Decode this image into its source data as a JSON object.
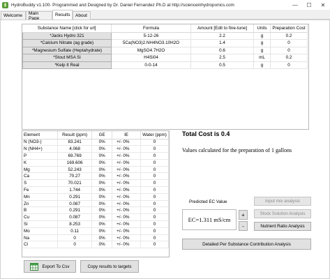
{
  "window": {
    "title": "HydroBuddy v1.100- Programmed and Designed by Dr. Daniel Fernandez Ph.D at http://scienceinhydroponics.com",
    "minimize_glyph": "—",
    "maximize_glyph": "☐",
    "close_glyph": "✕"
  },
  "tabs": [
    {
      "label": "Welcome"
    },
    {
      "label": "Main Page"
    },
    {
      "label": "Results"
    },
    {
      "label": "About"
    }
  ],
  "substances": {
    "columns": [
      "Substance Name [click for url]",
      "Formula",
      "Amount [Edit to fine-tune]",
      "Units",
      "Preparation Cost"
    ],
    "rows": [
      {
        "name": "*Jacks Hydro 321",
        "formula": "5-12-26",
        "amount": "2.2",
        "units": "g",
        "cost": "0.2"
      },
      {
        "name": "*Calcium Nitrate (ag grade)",
        "formula": "5Ca(NO3)2.NH4NO3.10H2O",
        "amount": "1.4",
        "units": "g",
        "cost": "0"
      },
      {
        "name": "*Magnesium Sulfate (Heptahydrate)",
        "formula": "MgSO4.7H2O",
        "amount": "0.6",
        "units": "g",
        "cost": "0"
      },
      {
        "name": "*Stout MSA Si",
        "formula": "H4Si04",
        "amount": "2.5",
        "units": "mL",
        "cost": "0.2"
      },
      {
        "name": "*Kelp It Real",
        "formula": "0-0-14",
        "amount": "0.5",
        "units": "g",
        "cost": "0"
      }
    ]
  },
  "elements": {
    "columns": [
      "Element",
      "Result (ppm)",
      "GE",
      "IE",
      "Water (ppm)"
    ],
    "rows": [
      {
        "element": "N (NO3-)",
        "result": "83.241",
        "ge": "0%",
        "ie": "+/- 0%",
        "water": "0"
      },
      {
        "element": "N (NH4+)",
        "result": "4.068",
        "ge": "0%",
        "ie": "+/- 0%",
        "water": "0"
      },
      {
        "element": "P",
        "result": "69.769",
        "ge": "0%",
        "ie": "+/- 0%",
        "water": "0"
      },
      {
        "element": "K",
        "result": "169.606",
        "ge": "0%",
        "ie": "+/- 0%",
        "water": "0"
      },
      {
        "element": "Mg",
        "result": "52.243",
        "ge": "0%",
        "ie": "+/- 0%",
        "water": "0"
      },
      {
        "element": "Ca",
        "result": "70.27",
        "ge": "0%",
        "ie": "+/- 0%",
        "water": "0"
      },
      {
        "element": "S",
        "result": "70.021",
        "ge": "0%",
        "ie": "+/- 0%",
        "water": "0"
      },
      {
        "element": "Fe",
        "result": "1.744",
        "ge": "0%",
        "ie": "+/- 0%",
        "water": "0"
      },
      {
        "element": "Mn",
        "result": "0.291",
        "ge": "0%",
        "ie": "+/- 0%",
        "water": "0"
      },
      {
        "element": "Zn",
        "result": "0.087",
        "ge": "0%",
        "ie": "+/- 0%",
        "water": "0"
      },
      {
        "element": "B",
        "result": "0.291",
        "ge": "0%",
        "ie": "+/- 0%",
        "water": "0"
      },
      {
        "element": "Cu",
        "result": "0.087",
        "ge": "0%",
        "ie": "+/- 0%",
        "water": "0"
      },
      {
        "element": "Si",
        "result": "8.253",
        "ge": "0%",
        "ie": "+/- 0%",
        "water": "0"
      },
      {
        "element": "Mo",
        "result": "0.11",
        "ge": "0%",
        "ie": "+/- 0%",
        "water": "0"
      },
      {
        "element": "Na",
        "result": "0",
        "ge": "0%",
        "ie": "+/- 0%",
        "water": "0"
      },
      {
        "element": "Cl",
        "result": "0",
        "ge": "0%",
        "ie": "+/- 0%",
        "water": "0"
      }
    ]
  },
  "summary": {
    "total_cost": "Total Cost is 0.4",
    "calc_note": "Values calculated for the preparation of 1 gallons"
  },
  "ec": {
    "label": "Predicted EC Value",
    "value": "EC=1.311 mS/cm",
    "plus": "+",
    "minus": "-"
  },
  "buttons": {
    "input_mix": "Input mix analysis",
    "stock_solution": "Stock Solution Analysis",
    "nutrient_ratio": "Nutrient Ratio Analysis",
    "detailed": "Detailed Per Substance Contribution Analysis",
    "export_csv": "Export To Csv",
    "copy_targets": "Copy results to targets"
  },
  "colors": {
    "button_bg": "#e1e1e1",
    "button_border": "#adadad",
    "disabled_text": "#8a8a8a",
    "panel_bg": "#f0f0f0"
  }
}
